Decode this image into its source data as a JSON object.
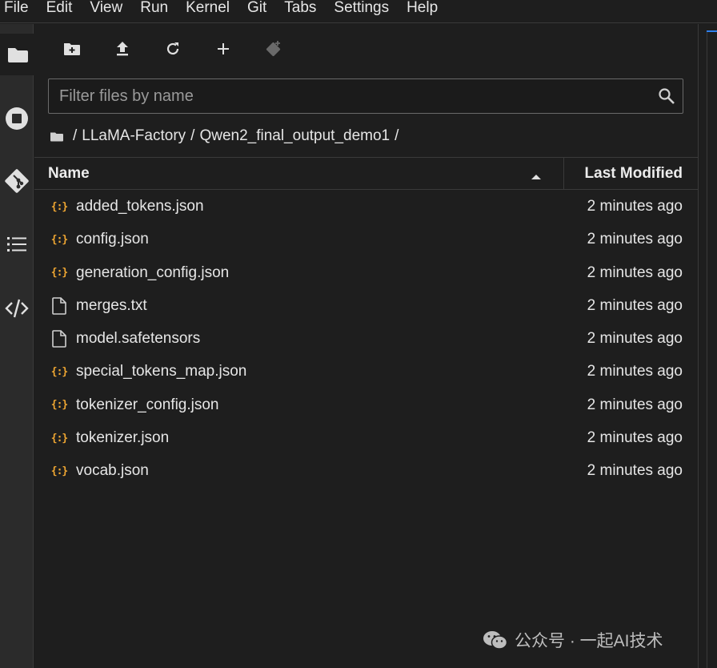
{
  "menubar": {
    "items": [
      "File",
      "Edit",
      "View",
      "Run",
      "Kernel",
      "Git",
      "Tabs",
      "Settings",
      "Help"
    ]
  },
  "activitybar": {
    "icons": [
      "folder-icon",
      "stop-circle-icon",
      "git-icon",
      "list-icon",
      "code-icon"
    ]
  },
  "toolbar": {
    "icons": [
      "new-folder-icon",
      "upload-icon",
      "refresh-icon",
      "add-icon",
      "git-clone-icon"
    ]
  },
  "filter": {
    "placeholder": "Filter files by name",
    "value": ""
  },
  "breadcrumbs": {
    "separator": "/",
    "items": [
      "LLaMA-Factory",
      "Qwen2_final_output_demo1"
    ],
    "trailing": "/"
  },
  "table": {
    "col_name": "Name",
    "col_modified": "Last Modified",
    "sort": "ascending",
    "rows": [
      {
        "name": "added_tokens.json",
        "type": "json",
        "modified": "2 minutes ago"
      },
      {
        "name": "config.json",
        "type": "json",
        "modified": "2 minutes ago"
      },
      {
        "name": "generation_config.json",
        "type": "json",
        "modified": "2 minutes ago"
      },
      {
        "name": "merges.txt",
        "type": "file",
        "modified": "2 minutes ago"
      },
      {
        "name": "model.safetensors",
        "type": "file",
        "modified": "2 minutes ago"
      },
      {
        "name": "special_tokens_map.json",
        "type": "json",
        "modified": "2 minutes ago"
      },
      {
        "name": "tokenizer_config.json",
        "type": "json",
        "modified": "2 minutes ago"
      },
      {
        "name": "tokenizer.json",
        "type": "json",
        "modified": "2 minutes ago"
      },
      {
        "name": "vocab.json",
        "type": "json",
        "modified": "2 minutes ago"
      }
    ]
  },
  "colors": {
    "background": "#1e1e1e",
    "json_icon": "#f0a732",
    "accent": "#2f80ed"
  },
  "watermark": {
    "text": "公众号 · 一起AI技术"
  }
}
